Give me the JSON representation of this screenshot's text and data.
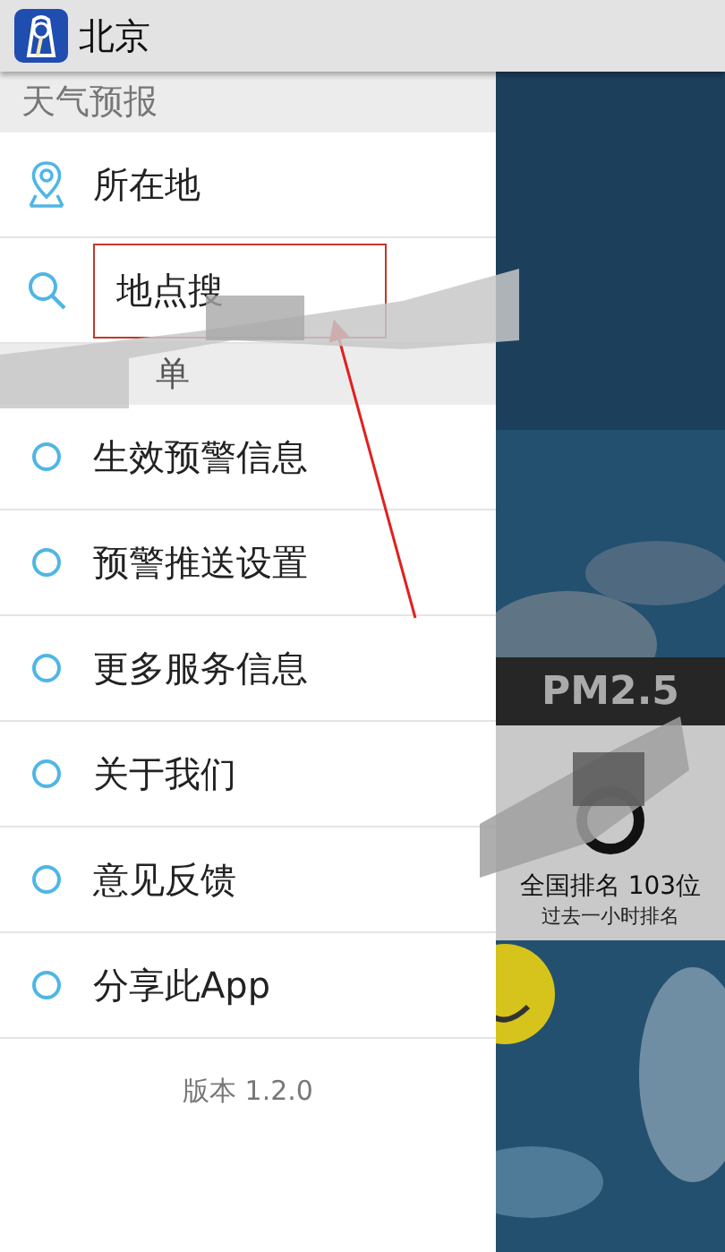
{
  "title_bar": {
    "title": "北京"
  },
  "drawer": {
    "sections": [
      {
        "header": "天气预报",
        "items": [
          {
            "kind": "location",
            "label": "所在地"
          },
          {
            "kind": "search",
            "label": "地点搜",
            "highlighted": true
          }
        ]
      },
      {
        "header": "单",
        "items": [
          {
            "kind": "circle",
            "label": "生效预警信息"
          },
          {
            "kind": "circle",
            "label": "预警推送设置"
          },
          {
            "kind": "circle",
            "label": "更多服务信息"
          },
          {
            "kind": "circle",
            "label": "关于我们"
          },
          {
            "kind": "circle",
            "label": "意见反馈"
          },
          {
            "kind": "circle",
            "label": "分享此App"
          }
        ]
      }
    ],
    "version": "版本 1.2.0"
  },
  "pm_card": {
    "title": "PM2.5",
    "rank": "全国排名 103位",
    "note": "过去一小时排名"
  }
}
